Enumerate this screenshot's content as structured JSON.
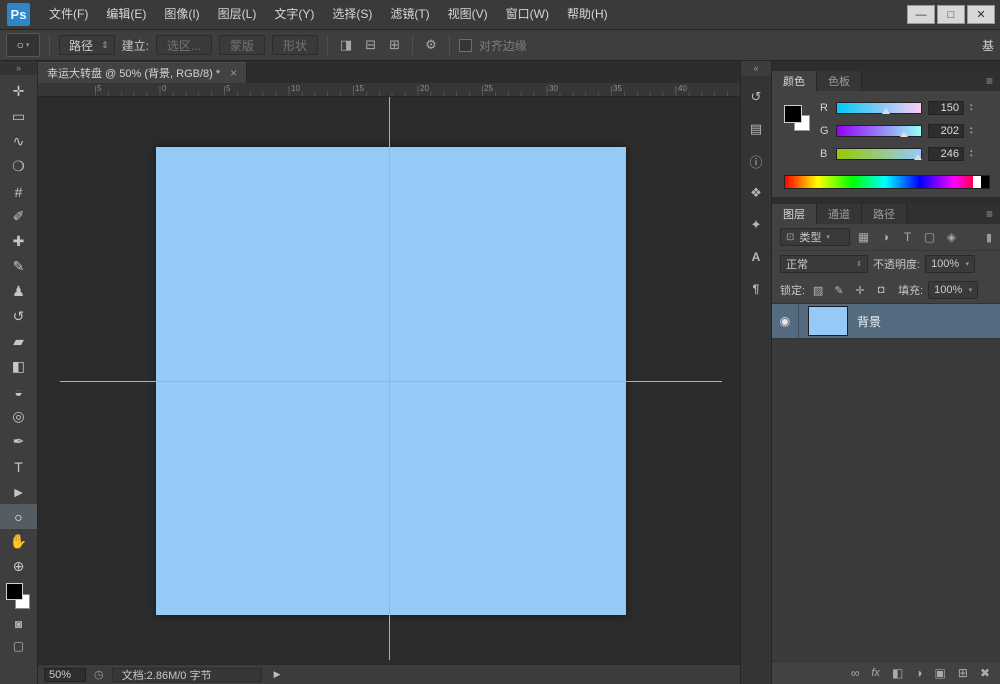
{
  "window": {
    "minimize_glyph": "—",
    "maximize_glyph": "□",
    "close_glyph": "✕"
  },
  "colors": {
    "canvas_fill": "#96caf6",
    "guide_cyan": "#35e3e6",
    "layer_selection": "#546a7e",
    "logo_blue": "#2e86c6"
  },
  "glyphs": {
    "caret": "▾",
    "double_arrow": "⇕",
    "spin_up": "▴",
    "spin_down": "▾",
    "menu": "≡",
    "collapse_left": "«",
    "collapse_right": "»"
  },
  "menu_bar": {
    "logo": "Ps",
    "items": [
      "文件(F)",
      "编辑(E)",
      "图像(I)",
      "图层(L)",
      "文字(Y)",
      "选择(S)",
      "滤镜(T)",
      "视图(V)",
      "窗口(W)",
      "帮助(H)"
    ]
  },
  "options_bar": {
    "tool_icon": "○",
    "mode_dropdown": "路径",
    "make_label": "建立:",
    "selection_button": "选区...",
    "mask_button": "蒙版",
    "shape_button": "形状",
    "path_ops_icon": "◨",
    "path_align_icon": "⊟",
    "path_arrange_icon": "⊞",
    "gear_icon": "⚙",
    "align_edges_label": "对齐边缘",
    "workspace_label": "基"
  },
  "toolbar": {
    "tools": [
      {
        "name": "move",
        "glyph": "✛"
      },
      {
        "name": "rectangular-marquee",
        "glyph": "▭"
      },
      {
        "name": "lasso",
        "glyph": "∿"
      },
      {
        "name": "quick-selection",
        "glyph": "❍"
      },
      {
        "name": "crop",
        "glyph": "#"
      },
      {
        "name": "eyedropper",
        "glyph": "✐"
      },
      {
        "name": "healing-brush",
        "glyph": "✚"
      },
      {
        "name": "brush",
        "glyph": "✎"
      },
      {
        "name": "clone-stamp",
        "glyph": "♟"
      },
      {
        "name": "history-brush",
        "glyph": "↺"
      },
      {
        "name": "eraser",
        "glyph": "▰"
      },
      {
        "name": "gradient",
        "glyph": "◧"
      },
      {
        "name": "blur",
        "glyph": "◒"
      },
      {
        "name": "dodge",
        "glyph": "◎"
      },
      {
        "name": "pen",
        "glyph": "✒"
      },
      {
        "name": "type",
        "glyph": "T"
      },
      {
        "name": "path-selection",
        "glyph": "►"
      },
      {
        "name": "ellipse",
        "glyph": "○",
        "active": true
      },
      {
        "name": "hand",
        "glyph": "✋"
      },
      {
        "name": "zoom",
        "glyph": "⊕"
      }
    ],
    "quick_mask_icon": "◙",
    "screen_mode_icon": "▢"
  },
  "document": {
    "tab_title": "幸运大转盘 @ 50% (背景, RGB/8) *",
    "close_icon": "×",
    "ruler_ticks": [
      "5",
      "0",
      "5",
      "10",
      "15",
      "20",
      "25",
      "30",
      "35",
      "40"
    ],
    "zoom": "50%",
    "status_icon": "◷",
    "status_info": "文档:2.86M/0 字节",
    "status_arrow": "▶"
  },
  "dock": {
    "icons": [
      "↺",
      "▤",
      "ⓘ",
      "❖",
      "✦",
      "A",
      "¶"
    ]
  },
  "color_panel": {
    "tabs": [
      "颜色",
      "色板"
    ],
    "channels": [
      {
        "label": "R",
        "value": "150"
      },
      {
        "label": "G",
        "value": "202"
      },
      {
        "label": "B",
        "value": "246"
      }
    ]
  },
  "layers_panel": {
    "tabs": [
      "图层",
      "通道",
      "路径"
    ],
    "filter": {
      "kind_icon": "⊡",
      "label": "类型",
      "icons": [
        "▦",
        "◑",
        "T",
        "▢",
        "◈"
      ],
      "toggle_icon": "▮"
    },
    "blend_mode": "正常",
    "opacity_label": "不透明度:",
    "opacity_value": "100%",
    "lock_label": "锁定:",
    "lock_icons": [
      "▨",
      "✎",
      "✛",
      "◘"
    ],
    "fill_label": "填充:",
    "fill_value": "100%",
    "layers": [
      {
        "eye_icon": "◉",
        "name": "背景"
      }
    ],
    "bottom_icons": [
      "∞",
      "fx",
      "◧",
      "◑",
      "▣",
      "⊞",
      "✖"
    ]
  }
}
